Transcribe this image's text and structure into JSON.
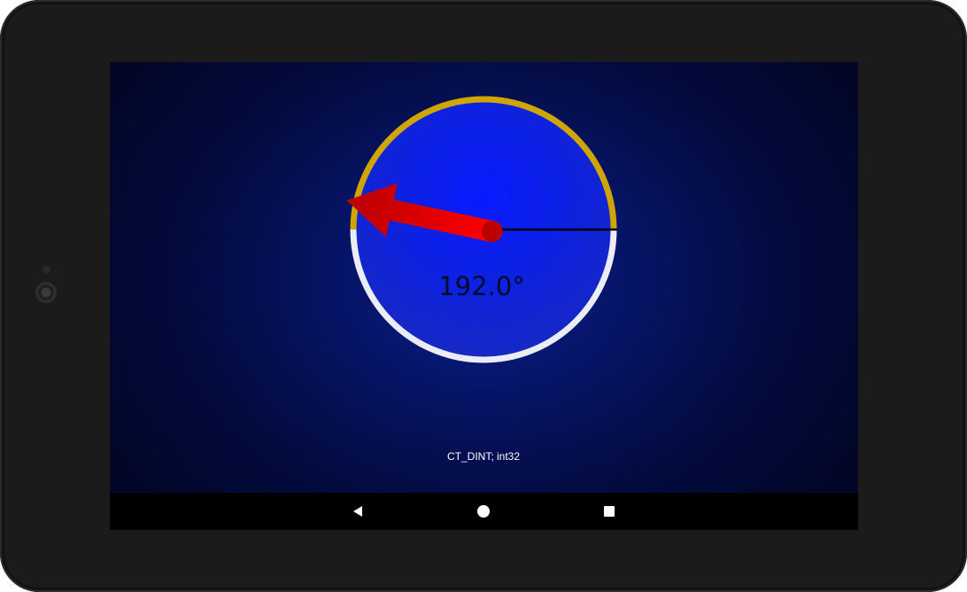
{
  "gauge": {
    "value_text": "192.0°",
    "angle_degrees": 192.0,
    "colors": {
      "dial_center": "#0a1cff",
      "dial_edge": "#1a2ad0",
      "ring_upper": "#cfa600",
      "ring_lower": "#ececf4",
      "needle": "#ee0000",
      "reference_line": "#000000"
    }
  },
  "type_label": "CT_DINT; int32",
  "navbar": {
    "back_icon": "back-triangle-icon",
    "home_icon": "home-circle-icon",
    "recents_icon": "recents-square-icon"
  }
}
